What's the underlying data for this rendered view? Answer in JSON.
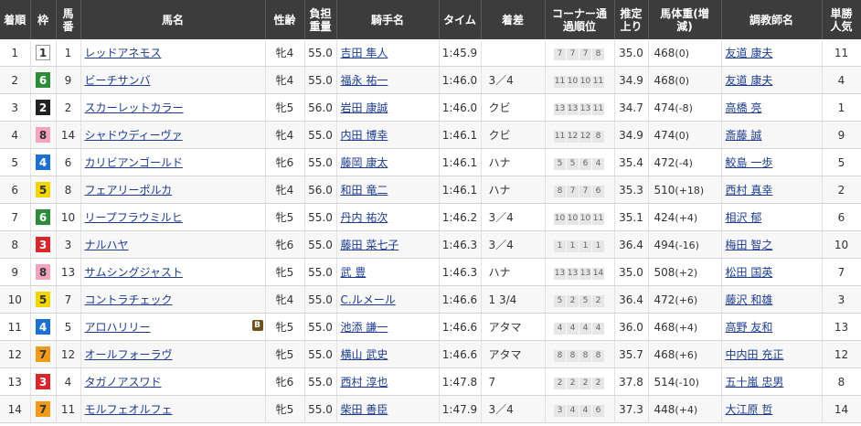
{
  "headers": [
    "着順",
    "枠",
    "馬番",
    "馬名",
    "性齢",
    "負担重量",
    "騎手名",
    "タイム",
    "着差",
    "コーナー通過順位",
    "推定上り",
    "馬体重(増減)",
    "調教師名",
    "単勝人気"
  ],
  "waku_colors": {
    "1": {
      "bg": "#ffffff",
      "fg": "#333333",
      "border": "#999999"
    },
    "2": {
      "bg": "#222222",
      "fg": "#ffffff",
      "border": "#222222"
    },
    "3": {
      "bg": "#d9262c",
      "fg": "#ffffff",
      "border": "#d9262c"
    },
    "4": {
      "bg": "#1d6fd1",
      "fg": "#ffffff",
      "border": "#1d6fd1"
    },
    "5": {
      "bg": "#f2d600",
      "fg": "#333333",
      "border": "#f2d600"
    },
    "6": {
      "bg": "#2e8b3a",
      "fg": "#ffffff",
      "border": "#2e8b3a"
    },
    "7": {
      "bg": "#f29b1a",
      "fg": "#333333",
      "border": "#f29b1a"
    },
    "8": {
      "bg": "#f5a3c0",
      "fg": "#333333",
      "border": "#f5a3c0"
    }
  },
  "rows": [
    {
      "rank": "1",
      "waku": "1",
      "num": "1",
      "horse": "レッドアネモス",
      "sexage": "牝4",
      "weight": "55.0",
      "jockey": "吉田 隼人",
      "time": "1:45.9",
      "margin": "",
      "corners": [
        "7",
        "7",
        "7",
        "8"
      ],
      "last3f": "35.0",
      "bw": "468",
      "bwdiff": "(0)",
      "trainer": "友道 康夫",
      "pop": "11",
      "blinker": ""
    },
    {
      "rank": "2",
      "waku": "6",
      "num": "9",
      "horse": "ビーチサンバ",
      "sexage": "牝4",
      "weight": "55.0",
      "jockey": "福永 祐一",
      "time": "1:46.0",
      "margin": "3／4",
      "corners": [
        "11",
        "10",
        "10",
        "11"
      ],
      "last3f": "34.9",
      "bw": "468",
      "bwdiff": "(0)",
      "trainer": "友道 康夫",
      "pop": "4",
      "blinker": ""
    },
    {
      "rank": "3",
      "waku": "2",
      "num": "2",
      "horse": "スカーレットカラー",
      "sexage": "牝5",
      "weight": "56.0",
      "jockey": "岩田 康誠",
      "time": "1:46.0",
      "margin": "クビ",
      "corners": [
        "13",
        "13",
        "13",
        "11"
      ],
      "last3f": "34.7",
      "bw": "474",
      "bwdiff": "(-8)",
      "trainer": "高橋 亮",
      "pop": "1",
      "blinker": ""
    },
    {
      "rank": "4",
      "waku": "8",
      "num": "14",
      "horse": "シャドウディーヴァ",
      "sexage": "牝4",
      "weight": "55.0",
      "jockey": "内田 博幸",
      "time": "1:46.1",
      "margin": "クビ",
      "corners": [
        "11",
        "12",
        "12",
        "8"
      ],
      "last3f": "34.9",
      "bw": "474",
      "bwdiff": "(0)",
      "trainer": "斎藤 誠",
      "pop": "9",
      "blinker": ""
    },
    {
      "rank": "5",
      "waku": "4",
      "num": "6",
      "horse": "カリビアンゴールド",
      "sexage": "牝6",
      "weight": "55.0",
      "jockey": "藤岡 康太",
      "time": "1:46.1",
      "margin": "ハナ",
      "corners": [
        "5",
        "5",
        "6",
        "4"
      ],
      "last3f": "35.4",
      "bw": "472",
      "bwdiff": "(-4)",
      "trainer": "鮫島 一歩",
      "pop": "5",
      "blinker": ""
    },
    {
      "rank": "6",
      "waku": "5",
      "num": "8",
      "horse": "フェアリーポルカ",
      "sexage": "牝4",
      "weight": "56.0",
      "jockey": "和田 竜二",
      "time": "1:46.1",
      "margin": "ハナ",
      "corners": [
        "8",
        "7",
        "7",
        "6"
      ],
      "last3f": "35.3",
      "bw": "510",
      "bwdiff": "(+18)",
      "trainer": "西村 真幸",
      "pop": "2",
      "blinker": ""
    },
    {
      "rank": "7",
      "waku": "6",
      "num": "10",
      "horse": "リープフラウミルヒ",
      "sexage": "牝5",
      "weight": "55.0",
      "jockey": "丹内 祐次",
      "time": "1:46.2",
      "margin": "3／4",
      "corners": [
        "10",
        "10",
        "10",
        "11"
      ],
      "last3f": "35.1",
      "bw": "424",
      "bwdiff": "(+4)",
      "trainer": "相沢 郁",
      "pop": "6",
      "blinker": ""
    },
    {
      "rank": "8",
      "waku": "3",
      "num": "3",
      "horse": "ナルハヤ",
      "sexage": "牝6",
      "weight": "55.0",
      "jockey": "藤田 菜七子",
      "time": "1:46.3",
      "margin": "3／4",
      "corners": [
        "1",
        "1",
        "1",
        "1"
      ],
      "last3f": "36.4",
      "bw": "494",
      "bwdiff": "(-16)",
      "trainer": "梅田 智之",
      "pop": "10",
      "blinker": ""
    },
    {
      "rank": "9",
      "waku": "8",
      "num": "13",
      "horse": "サムシングジャスト",
      "sexage": "牝5",
      "weight": "55.0",
      "jockey": "武 豊",
      "time": "1:46.3",
      "margin": "ハナ",
      "corners": [
        "13",
        "13",
        "13",
        "14"
      ],
      "last3f": "35.0",
      "bw": "508",
      "bwdiff": "(+2)",
      "trainer": "松田 国英",
      "pop": "7",
      "blinker": ""
    },
    {
      "rank": "10",
      "waku": "5",
      "num": "7",
      "horse": "コントラチェック",
      "sexage": "牝4",
      "weight": "55.0",
      "jockey": "C.ルメール",
      "time": "1:46.6",
      "margin": "1 3/4",
      "corners": [
        "5",
        "2",
        "5",
        "2"
      ],
      "last3f": "36.4",
      "bw": "472",
      "bwdiff": "(+6)",
      "trainer": "藤沢 和雄",
      "pop": "3",
      "blinker": ""
    },
    {
      "rank": "11",
      "waku": "4",
      "num": "5",
      "horse": "アロハリリー",
      "sexage": "牝5",
      "weight": "55.0",
      "jockey": "池添 謙一",
      "time": "1:46.6",
      "margin": "アタマ",
      "corners": [
        "4",
        "4",
        "4",
        "4"
      ],
      "last3f": "36.0",
      "bw": "468",
      "bwdiff": "(+4)",
      "trainer": "高野 友和",
      "pop": "13",
      "blinker": "B"
    },
    {
      "rank": "12",
      "waku": "7",
      "num": "12",
      "horse": "オールフォーラヴ",
      "sexage": "牝5",
      "weight": "55.0",
      "jockey": "横山 武史",
      "time": "1:46.6",
      "margin": "アタマ",
      "corners": [
        "8",
        "8",
        "8",
        "8"
      ],
      "last3f": "35.7",
      "bw": "468",
      "bwdiff": "(+6)",
      "trainer": "中内田 充正",
      "pop": "12",
      "blinker": ""
    },
    {
      "rank": "13",
      "waku": "3",
      "num": "4",
      "horse": "タガノアスワド",
      "sexage": "牝6",
      "weight": "55.0",
      "jockey": "西村 淳也",
      "time": "1:47.8",
      "margin": "7",
      "corners": [
        "2",
        "2",
        "2",
        "2"
      ],
      "last3f": "37.8",
      "bw": "514",
      "bwdiff": "(-10)",
      "trainer": "五十嵐 忠男",
      "pop": "8",
      "blinker": ""
    },
    {
      "rank": "14",
      "waku": "7",
      "num": "11",
      "horse": "モルフェオルフェ",
      "sexage": "牝5",
      "weight": "55.0",
      "jockey": "柴田 善臣",
      "time": "1:47.9",
      "margin": "3／4",
      "corners": [
        "3",
        "4",
        "4",
        "6"
      ],
      "last3f": "37.3",
      "bw": "448",
      "bwdiff": "(+4)",
      "trainer": "大江原 哲",
      "pop": "14",
      "blinker": ""
    }
  ]
}
